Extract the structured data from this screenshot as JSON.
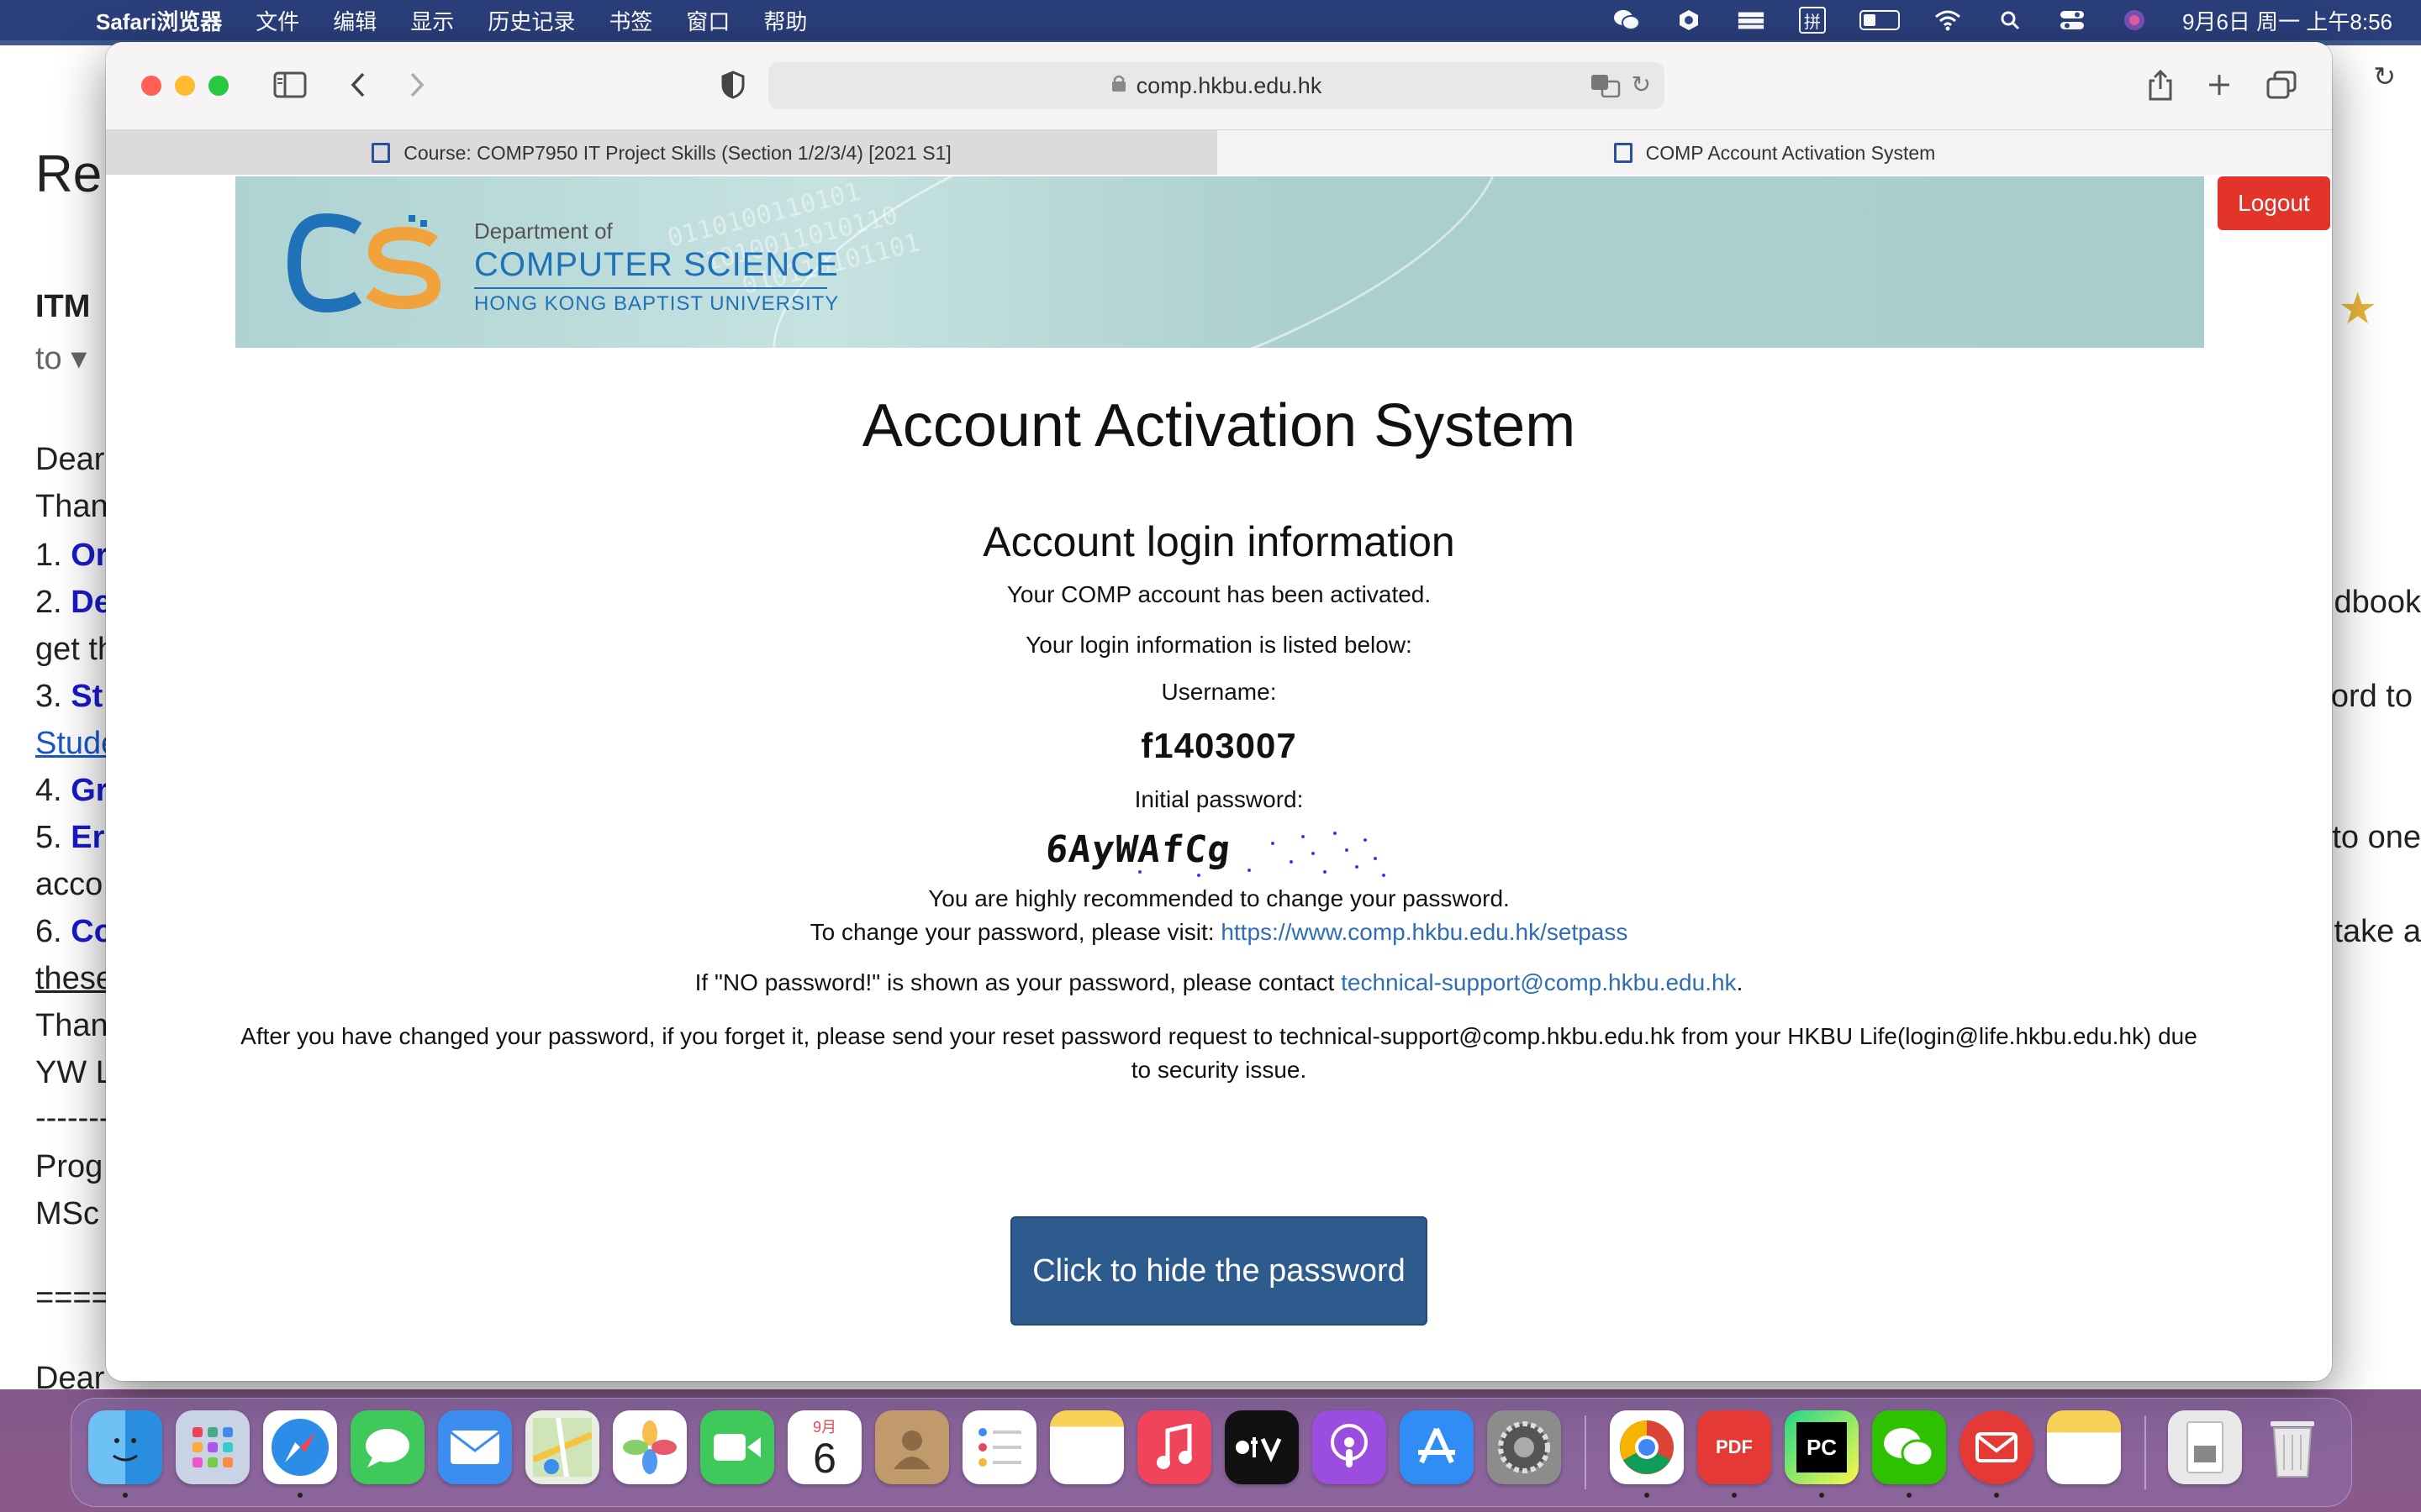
{
  "menubar": {
    "app_name": "Safari浏览器",
    "items": [
      "文件",
      "编辑",
      "显示",
      "历史记录",
      "书签",
      "窗口",
      "帮助"
    ],
    "clock": "9月6日 周一 上午8:56",
    "ime": "拼"
  },
  "background_window": {
    "lines": [
      {
        "text": "Re:",
        "style": "title"
      },
      {
        "text": "ITM",
        "style": "bold"
      },
      {
        "text": "to ▾",
        "style": "gray"
      },
      {
        "text": "Dear",
        "style": "normal"
      },
      {
        "text": "Than",
        "style": "normal"
      },
      {
        "text": "1. ",
        "suffix": "Or",
        "style": "numbered"
      },
      {
        "text": "2. ",
        "suffix": "De",
        "style": "numbered"
      },
      {
        "text": "get th",
        "style": "normal"
      },
      {
        "text": "3. ",
        "suffix": "St",
        "style": "numbered"
      },
      {
        "text": "Stude",
        "style": "link"
      },
      {
        "text": "4. ",
        "suffix": "Gr",
        "style": "numbered"
      },
      {
        "text": "5. ",
        "suffix": "Er",
        "style": "numbered"
      },
      {
        "text": "acco",
        "style": "normal"
      },
      {
        "text": "6. ",
        "suffix": "Co",
        "style": "numbered"
      },
      {
        "text": "these",
        "style": "underline"
      },
      {
        "text": "Than",
        "style": "normal"
      },
      {
        "text": "YW L",
        "style": "normal"
      },
      {
        "text": "-------",
        "style": "normal"
      },
      {
        "text": "Prog",
        "style": "normal"
      },
      {
        "text": "MSc",
        "style": "normal"
      },
      {
        "text": "=====",
        "style": "normal"
      },
      {
        "text": "Dear",
        "style": "normal"
      }
    ],
    "right_fragments": [
      "ndbook",
      "ord to",
      "to one",
      "take a"
    ]
  },
  "browser": {
    "url": "comp.hkbu.edu.hk",
    "tabs": [
      {
        "title": "Course: COMP7950 IT Project Skills (Section 1/2/3/4) [2021 S1]"
      },
      {
        "title": "COMP Account Activation System"
      }
    ]
  },
  "banner": {
    "department_label": "Department of",
    "department_name": "COMPUTER SCIENCE",
    "university": "HONG KONG BAPTIST UNIVERSITY"
  },
  "logout_label": "Logout",
  "content": {
    "title": "Account Activation System",
    "section_title": "Account login information",
    "activated_msg": "Your COMP account has been activated.",
    "login_info_msg": "Your login information is listed below:",
    "username_label": "Username:",
    "username": "f1403007",
    "password_label": "Initial password:",
    "password": "6AyWAfCg",
    "recommend_msg": "You are highly recommended to change your password.",
    "change_msg_prefix": "To change your password, please visit: ",
    "change_link": "https://www.comp.hkbu.edu.hk/setpass",
    "nopass_prefix": "If \"NO password!\" is shown as your password, please contact ",
    "nopass_link": "technical-support@comp.hkbu.edu.hk",
    "nopass_suffix": ".",
    "reset_msg": "After you have changed your password, if you forget it, please send your reset password request to technical-support@comp.hkbu.edu.hk from your HKBU Life(login@life.hkbu.edu.hk) due to security issue.",
    "hide_button": "Click to hide the password"
  },
  "dock": {
    "calendar_month": "9月",
    "calendar_day": "6",
    "apps": [
      "finder",
      "launchpad",
      "safari",
      "messages",
      "mail",
      "maps",
      "photos",
      "facetime",
      "calendar",
      "contacts",
      "reminders",
      "notes",
      "music",
      "tv",
      "podcasts",
      "app-store",
      "system-preferences",
      "chrome",
      "pdf-expert",
      "pycharm",
      "wechat",
      "airmail",
      "notes-widget",
      "downloads",
      "trash"
    ]
  },
  "colors": {
    "logout": "#e3342a",
    "hide_button": "#2e5b8d",
    "link": "#2f6db5",
    "banner": "#aed3d2"
  }
}
